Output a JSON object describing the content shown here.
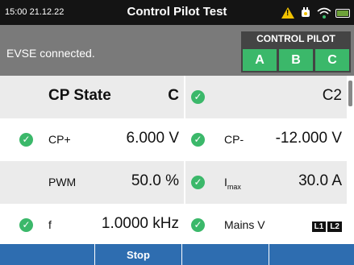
{
  "status_bar": {
    "time": "15:00 21.12.22",
    "title": "Control Pilot Test"
  },
  "connection": {
    "text": "EVSE connected."
  },
  "control_pilot": {
    "label": "CONTROL PILOT",
    "letters": [
      "A",
      "B",
      "C"
    ],
    "active_color": "#3bb86a"
  },
  "readings": {
    "cp_state": {
      "label": "CP State",
      "value": "C",
      "right_value": "C2"
    },
    "cp_plus": {
      "label": "CP+",
      "value": "6.000 V"
    },
    "cp_minus": {
      "label": "CP-",
      "value": "-12.000 V"
    },
    "pwm": {
      "label": "PWM",
      "value": "50.0 %"
    },
    "imax": {
      "label_main": "I",
      "label_sub": "max",
      "value": "30.0 A"
    },
    "freq": {
      "label": "f",
      "value": "1.0000 kHz"
    },
    "mains": {
      "label": "Mains V",
      "badges": [
        "L1",
        "L2"
      ]
    }
  },
  "bottom_bar": {
    "buttons": [
      "",
      "Stop",
      "",
      "",
      ""
    ]
  },
  "colors": {
    "check_green": "#3bb86a",
    "button_blue": "#2e6db0"
  }
}
